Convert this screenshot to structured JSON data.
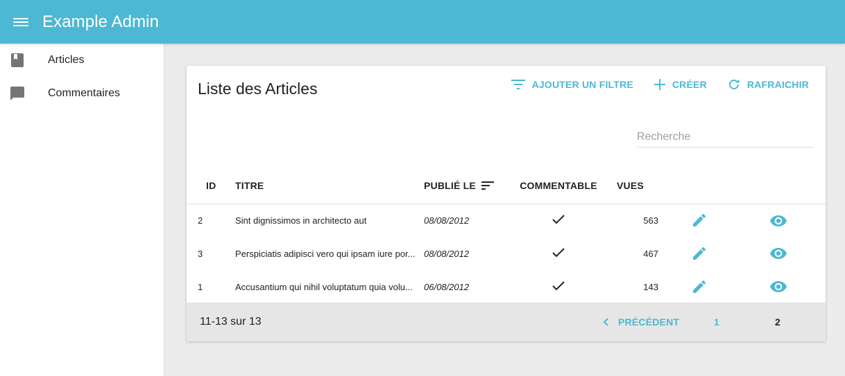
{
  "app": {
    "title": "Example Admin"
  },
  "colors": {
    "accent": "#4cb8d4",
    "appbar": "#4cb8d4"
  },
  "sidebar": {
    "items": [
      {
        "label": "Articles",
        "icon": "book-icon"
      },
      {
        "label": "Commentaires",
        "icon": "chat-bubble-icon"
      }
    ]
  },
  "list": {
    "title": "Liste des Articles",
    "actions": {
      "add_filter": "AJOUTER UN FILTRE",
      "create": "CRÉER",
      "refresh": "RAFRAICHIR"
    },
    "search": {
      "placeholder": "Recherche",
      "value": ""
    },
    "columns": {
      "id": "ID",
      "title": "TITRE",
      "published": "PUBLIÉ LE",
      "commentable": "COMMENTABLE",
      "views": "VUES"
    },
    "rows": [
      {
        "id": "2",
        "title": "Sint dignissimos in architecto aut",
        "published": "08/08/2012",
        "commentable": true,
        "views": "563"
      },
      {
        "id": "3",
        "title": "Perspiciatis adipisci vero qui ipsam iure por...",
        "published": "08/08/2012",
        "commentable": true,
        "views": "467"
      },
      {
        "id": "1",
        "title": "Accusantium qui nihil voluptatum quia volu...",
        "published": "06/08/2012",
        "commentable": true,
        "views": "143"
      }
    ],
    "pagination": {
      "range": "11-13 sur 13",
      "prev": "PRÉCÉDENT",
      "pages": [
        "1",
        "2"
      ],
      "current": "2"
    }
  }
}
